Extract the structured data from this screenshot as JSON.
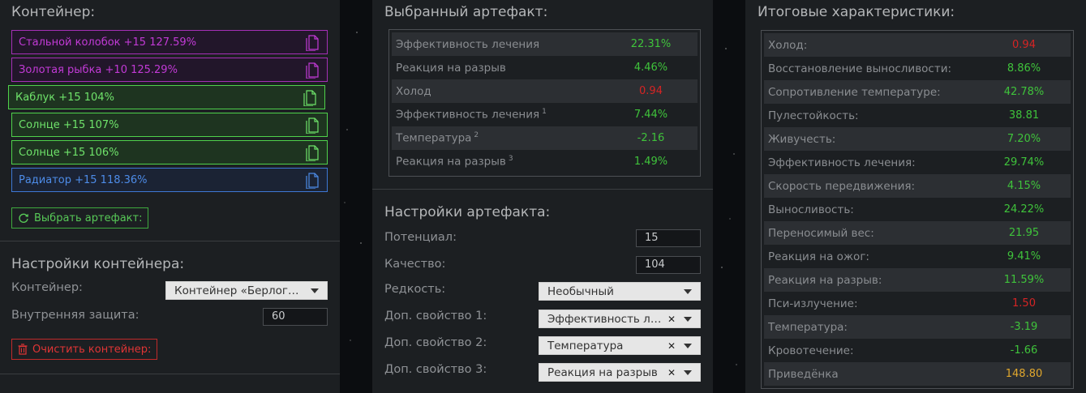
{
  "container": {
    "title": "Контейнер:",
    "items": [
      {
        "label": "Стальной колобок +15 127.59%",
        "color": "#c23ad6"
      },
      {
        "label": "Золотая рыбка +10 125.29%",
        "color": "#c23ad6"
      },
      {
        "label": "Каблук +15 104%",
        "color": "#6fe36a"
      },
      {
        "label": "Солнце +15 107%",
        "color": "#6fe36a"
      },
      {
        "label": "Солнце +15 106%",
        "color": "#6fe36a"
      },
      {
        "label": "Радиатор +15 118.36%",
        "color": "#4d8ce8"
      }
    ],
    "select_button": "Выбрать артефакт:",
    "settings_title": "Настройки контейнера:",
    "container_label": "Контейнер:",
    "container_value": "Контейнер «Берлога...",
    "protection_label": "Внутренняя защита:",
    "protection_value": "60",
    "clear_button": "Очистить контейнер:"
  },
  "artifact": {
    "title": "Выбранный артефакт:",
    "stats": [
      {
        "name": "Эффективность лечения",
        "sup": "",
        "value": "22.31%",
        "color": "#3fc33b"
      },
      {
        "name": "Реакция на разрыв",
        "sup": "",
        "value": "4.46%",
        "color": "#3fc33b"
      },
      {
        "name": "Холод",
        "sup": "",
        "value": "0.94",
        "color": "#d62424"
      },
      {
        "name": "Эффективность лечения",
        "sup": "1",
        "value": "7.44%",
        "color": "#3fc33b"
      },
      {
        "name": "Температура",
        "sup": "2",
        "value": "-2.16",
        "color": "#3fc33b"
      },
      {
        "name": "Реакция на разрыв",
        "sup": "3",
        "value": "1.49%",
        "color": "#3fc33b"
      }
    ],
    "settings_title": "Настройки артефакта:",
    "potential_label": "Потенциал:",
    "potential_value": "15",
    "quality_label": "Качество:",
    "quality_value": "104",
    "rarity_label": "Редкость:",
    "rarity_value": "Необычный",
    "extra1_label": "Доп. свойство 1:",
    "extra1_value": "Эффективность ле...",
    "extra2_label": "Доп. свойство 2:",
    "extra2_value": "Температура",
    "extra3_label": "Доп. свойство 3:",
    "extra3_value": "Реакция на разрыв"
  },
  "totals": {
    "title": "Итоговые характеристики:",
    "stats": [
      {
        "name": "Холод:",
        "value": "0.94",
        "color": "#d62424"
      },
      {
        "name": "Восстановление выносливости:",
        "value": "8.86%",
        "color": "#3fc33b"
      },
      {
        "name": "Сопротивление температуре:",
        "value": "42.78%",
        "color": "#3fc33b"
      },
      {
        "name": "Пулестойкость:",
        "value": "38.81",
        "color": "#3fc33b"
      },
      {
        "name": "Живучесть:",
        "value": "7.20%",
        "color": "#3fc33b"
      },
      {
        "name": "Эффективность лечения:",
        "value": "29.74%",
        "color": "#3fc33b"
      },
      {
        "name": "Скорость передвижения:",
        "value": "4.15%",
        "color": "#3fc33b"
      },
      {
        "name": "Выносливость:",
        "value": "24.22%",
        "color": "#3fc33b"
      },
      {
        "name": "Переносимый вес:",
        "value": "21.95",
        "color": "#3fc33b"
      },
      {
        "name": "Реакция на ожог:",
        "value": "9.41%",
        "color": "#3fc33b"
      },
      {
        "name": "Реакция на разрыв:",
        "value": "11.59%",
        "color": "#3fc33b"
      },
      {
        "name": "Пси-излучение:",
        "value": "1.50",
        "color": "#d62424"
      },
      {
        "name": "Температура:",
        "value": "-3.19",
        "color": "#3fc33b"
      },
      {
        "name": "Кровотечение:",
        "value": "-1.66",
        "color": "#3fc33b"
      },
      {
        "name": "Приведёнка",
        "value": "148.80",
        "color": "#e0a72d"
      }
    ]
  }
}
